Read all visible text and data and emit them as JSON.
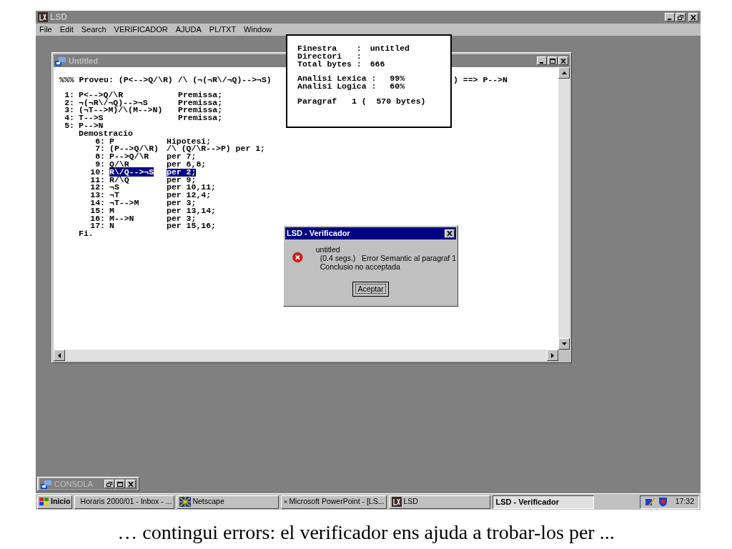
{
  "app": {
    "title": "LSD",
    "menu": [
      {
        "label": "File"
      },
      {
        "label": "Edit"
      },
      {
        "label": "Search"
      },
      {
        "label": "VERIFICADOR"
      },
      {
        "label": "AJUDA"
      },
      {
        "label": "PL/TXT"
      },
      {
        "label": "Window"
      }
    ]
  },
  "editor": {
    "title": "Untitled",
    "header_left": "%%% Proveu: (P<-->Q/\\R) /\\ (¬(¬R\\/¬Q)-->¬S)",
    "header_right": ") ==> P-->N",
    "premises": [
      {
        "num": "1:",
        "formula": "P<-->Q/\\R",
        "justification": "Premissa;"
      },
      {
        "num": "2:",
        "formula": "¬(¬R\\/¬Q)-->¬S",
        "justification": "Premissa;"
      },
      {
        "num": "3:",
        "formula": "(¬T-->M)/\\(M-->N)",
        "justification": "Premissa;"
      },
      {
        "num": "4:",
        "formula": "T-->S",
        "justification": "Premissa;"
      },
      {
        "num": "5:",
        "formula": "P-->N"
      }
    ],
    "demo_label": "Demostracio",
    "steps": [
      {
        "num": "6:",
        "formula": "P",
        "justification": "Hipotesi;",
        "selected": false
      },
      {
        "num": "7:",
        "formula": "(P-->Q/\\R)",
        "justification": "/\\ (Q/\\R-->P) per 1;",
        "selected": false
      },
      {
        "num": "8:",
        "formula": "P-->Q/\\R",
        "justification": "per 7;",
        "selected": false
      },
      {
        "num": "9:",
        "formula": "Q/\\R",
        "justification": "per 6,8;",
        "selected": false
      },
      {
        "num": "10:",
        "formula": "R\\/Q-->¬S",
        "justification": "per 2;",
        "selected": true
      },
      {
        "num": "11:",
        "formula": "R/\\Q",
        "justification": "per 9;",
        "selected": false
      },
      {
        "num": "12:",
        "formula": "¬S",
        "justification": "per 10,11;",
        "selected": false
      },
      {
        "num": "13:",
        "formula": "¬T",
        "justification": "per 12,4;",
        "selected": false
      },
      {
        "num": "14:",
        "formula": "¬T-->M",
        "justification": "per 3;",
        "selected": false
      },
      {
        "num": "15:",
        "formula": "M",
        "justification": "per 13,14;",
        "selected": false
      },
      {
        "num": "16:",
        "formula": "M-->N",
        "justification": "per 3;",
        "selected": false
      },
      {
        "num": "17:",
        "formula": "N",
        "justification": "per 15,16;",
        "selected": false
      }
    ],
    "end": "Fi."
  },
  "info_box": {
    "groups": [
      [
        {
          "label": "Finestra    :",
          "value": "untitled"
        },
        {
          "label": "Directori   :"
        },
        {
          "label": "Total bytes :",
          "value": "666"
        }
      ],
      [
        {
          "label": "Analisi Lexica :",
          "value": " 99%"
        },
        {
          "label": "Analisi Logica :",
          "value": " 60%"
        }
      ],
      [
        {
          "label": "Paragraf   1 (  570 bytes)"
        }
      ]
    ]
  },
  "dialog": {
    "title": "LSD - Verificador",
    "lines": [
      "untitled",
      "(0.4 segs.)   Error Semantic al paragraf 1",
      "Conclusio no acceptada"
    ],
    "button": "Aceptar"
  },
  "console": {
    "title": "CONSOLA"
  },
  "taskbar": {
    "start": "Inicio",
    "items": [
      {
        "label": "Horaris 2000/01 - Inbox - ...",
        "selected": false
      },
      {
        "label": "Netscape",
        "selected": false
      },
      {
        "label": "Microsoft PowerPoint - [LS...",
        "selected": false
      },
      {
        "label": "LSD",
        "selected": false
      },
      {
        "label": "LSD - Verificador",
        "selected": true
      }
    ],
    "time": "17:32"
  },
  "caption": "… contingui errors: el verificador ens ajuda a trobar-los per ..."
}
